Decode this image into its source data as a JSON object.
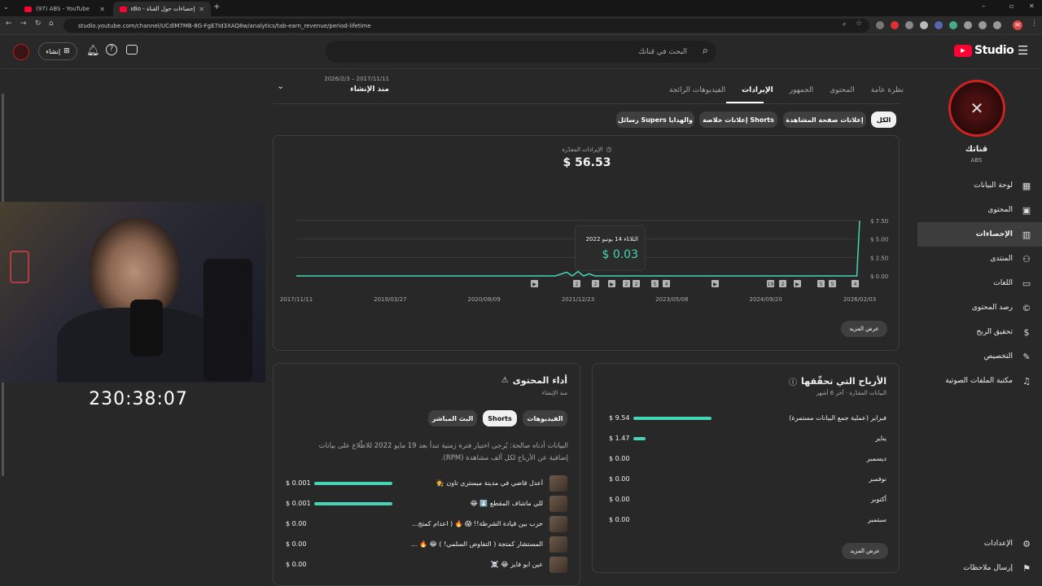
{
  "browser": {
    "tabs": [
      {
        "label": "(97) ABS - YouTube",
        "close": "✕"
      },
      {
        "label": "إحصاءات حول القناة - YouTube Studio",
        "close": "✕"
      }
    ],
    "new_tab": "+",
    "url": "studio.youtube.com/channel/UCdlM7MB-8G-FgE7Id3XAQ8w/analytics/tab-earn_revenue/period-lifetime",
    "profile_letter": "M"
  },
  "header": {
    "brand": "Studio",
    "search_placeholder": "البحث في قناتك",
    "create_label": "إنشاء"
  },
  "channel": {
    "name": "قناتك",
    "handle": "ABS"
  },
  "sidebar": {
    "items": [
      {
        "label": "لوحة البيانات",
        "icon": "dashboard-icon"
      },
      {
        "label": "المحتوى",
        "icon": "content-icon"
      },
      {
        "label": "الإحصاءات",
        "icon": "analytics-icon"
      },
      {
        "label": "المنتدى",
        "icon": "community-icon"
      },
      {
        "label": "اللغات",
        "icon": "subtitles-icon"
      },
      {
        "label": "رصد المحتوى",
        "icon": "copyright-icon"
      },
      {
        "label": "تحقيق الربح",
        "icon": "monetization-icon"
      },
      {
        "label": "التخصيص",
        "icon": "customization-icon"
      },
      {
        "label": "مكتبة الملفات الصوتية",
        "icon": "audio-library-icon"
      }
    ],
    "settings": "الإعدادات",
    "feedback": "إرسال ملاحظات"
  },
  "tabs": [
    "نظرة عامة",
    "المحتوى",
    "الجمهور",
    "الإيرادات",
    "الفيديوهات الرائجة"
  ],
  "date_range": {
    "range": "2026/2/3 – 2017/11/11",
    "label": "منذ الإنشاء"
  },
  "chips": [
    "الكل",
    "إعلانات صفحة المشاهدة",
    "إعلانات خلاصة Shorts",
    "رسائل Supers والهدايا"
  ],
  "revenue": {
    "label": "الإيرادات المقدّرة",
    "value": "$ 56.53"
  },
  "chart_data": {
    "type": "line",
    "x_ticks": [
      "2017/11/11",
      "2019/03/27",
      "2020/08/09",
      "2021/12/23",
      "2023/05/08",
      "2024/09/20",
      "2026/02/03"
    ],
    "y_ticks": [
      "$ 0.00",
      "$ 2.50",
      "$ 5.00",
      "$ 7.50"
    ],
    "ylim": [
      0,
      7.5
    ],
    "series": [
      {
        "values": [
          [
            0,
            0
          ],
          [
            0.46,
            0
          ],
          [
            0.48,
            0.5
          ],
          [
            0.49,
            0
          ],
          [
            0.5,
            0.6
          ],
          [
            0.51,
            0
          ],
          [
            0.52,
            0.3
          ],
          [
            0.53,
            0
          ],
          [
            0.995,
            0
          ],
          [
            1.0,
            7.5
          ]
        ]
      }
    ],
    "tooltip": {
      "date": "الثلاثاء 14 يونيو 2022",
      "value": "$ 0.03"
    },
    "markers": [
      "▶",
      "2",
      "2",
      "▶",
      "2",
      "2",
      "5",
      "4",
      "▶",
      "19",
      "2",
      "▶",
      "5",
      "5",
      "4"
    ]
  },
  "show_more": "عرض المزيد",
  "earnings": {
    "title": "الأرباح التي تحقّقها",
    "subtitle": "البيانات المقدّرة · آخر 6 أشهر",
    "rows": [
      {
        "month": "فبراير (عملية جمع البيانات مستمرة)",
        "value": "$ 9.54",
        "frac": 1.0
      },
      {
        "month": "يناير",
        "value": "$ 1.47",
        "frac": 0.154
      },
      {
        "month": "ديسمبر",
        "value": "$ 0.00",
        "frac": 0
      },
      {
        "month": "نوفمبر",
        "value": "$ 0.00",
        "frac": 0
      },
      {
        "month": "أكتوبر",
        "value": "$ 0.00",
        "frac": 0
      },
      {
        "month": "سبتمبر",
        "value": "$ 0.00",
        "frac": 0
      }
    ]
  },
  "performance": {
    "title": "أداء المحتوى",
    "subtitle": "منذ الإنشاء",
    "chips": [
      "الفيديوهات",
      "Shorts",
      "البث المباشر"
    ],
    "note": "البيانات أدناه صالحة: يُرجى اختيار فترة زمنية تبدأ بعد 19 مايو 2022 للاطّلاع على بيانات إضافية عن الأرباح لكل ألف مشاهدة (RPM).",
    "rows": [
      {
        "title": "أعدل قاضي في مدينة ميستري تاون 🧑‍⚖️",
        "value": "$ 0.001",
        "frac": 1.0
      },
      {
        "title": "للي ماشاف المقطع ⬇️ 😂",
        "value": "$ 0.001",
        "frac": 1.0
      },
      {
        "title": "حرب بين قيادة الشرطة!! 😱 🔥 ( اعدام كمتج...",
        "value": "$ 0.00",
        "frac": 0
      },
      {
        "title": "المستشار كمتجة ( التفاوض السلمي! ) 😂 🔥 ...",
        "value": "$ 0.00",
        "frac": 0
      },
      {
        "title": "عين ابو فايز 😂 ☠️",
        "value": "$ 0.00",
        "frac": 0
      }
    ]
  },
  "timer": "230:38:07"
}
